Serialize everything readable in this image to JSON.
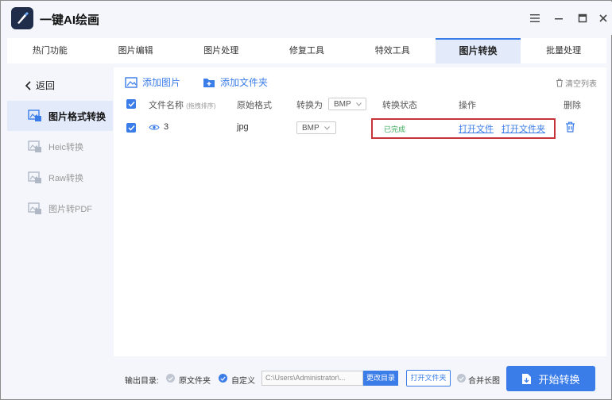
{
  "app": {
    "title": "一键AI绘画"
  },
  "tabs": [
    {
      "label": "热门功能"
    },
    {
      "label": "图片编辑"
    },
    {
      "label": "图片处理"
    },
    {
      "label": "修复工具"
    },
    {
      "label": "特效工具"
    },
    {
      "label": "图片转换",
      "active": true
    },
    {
      "label": "批量处理"
    }
  ],
  "sidebar": {
    "back_label": "返回",
    "items": [
      {
        "label": "图片格式转换",
        "active": true
      },
      {
        "label": "Heic转换"
      },
      {
        "label": "Raw转换"
      },
      {
        "label": "图片转PDF"
      }
    ]
  },
  "toolbar": {
    "add_image": "添加图片",
    "add_folder": "添加文件夹",
    "clear_list": "清空列表"
  },
  "table": {
    "headers": {
      "filename": "文件名称",
      "filename_hint": "(拖拽排序)",
      "orig_format": "原始格式",
      "convert_to": "转换为",
      "convert_to_value": "BMP",
      "status": "转换状态",
      "action": "操作",
      "delete": "删除"
    },
    "rows": [
      {
        "name": "3",
        "orig_format": "jpg",
        "target_format": "BMP",
        "status": "已完成",
        "open_file": "打开文件",
        "open_folder": "打开文件夹"
      }
    ]
  },
  "footer": {
    "output_label": "输出目录:",
    "option_original": "原文件夹",
    "option_custom": "自定义",
    "path_value": "C:\\Users\\Administrator\\...",
    "change_dir": "更改目录",
    "open_folder": "打开文件夹",
    "merge_long": "合并长图",
    "start": "开始转换"
  },
  "colors": {
    "accent": "#3b7de8",
    "status_done": "#3aa85a",
    "highlight": "#c9343a"
  }
}
